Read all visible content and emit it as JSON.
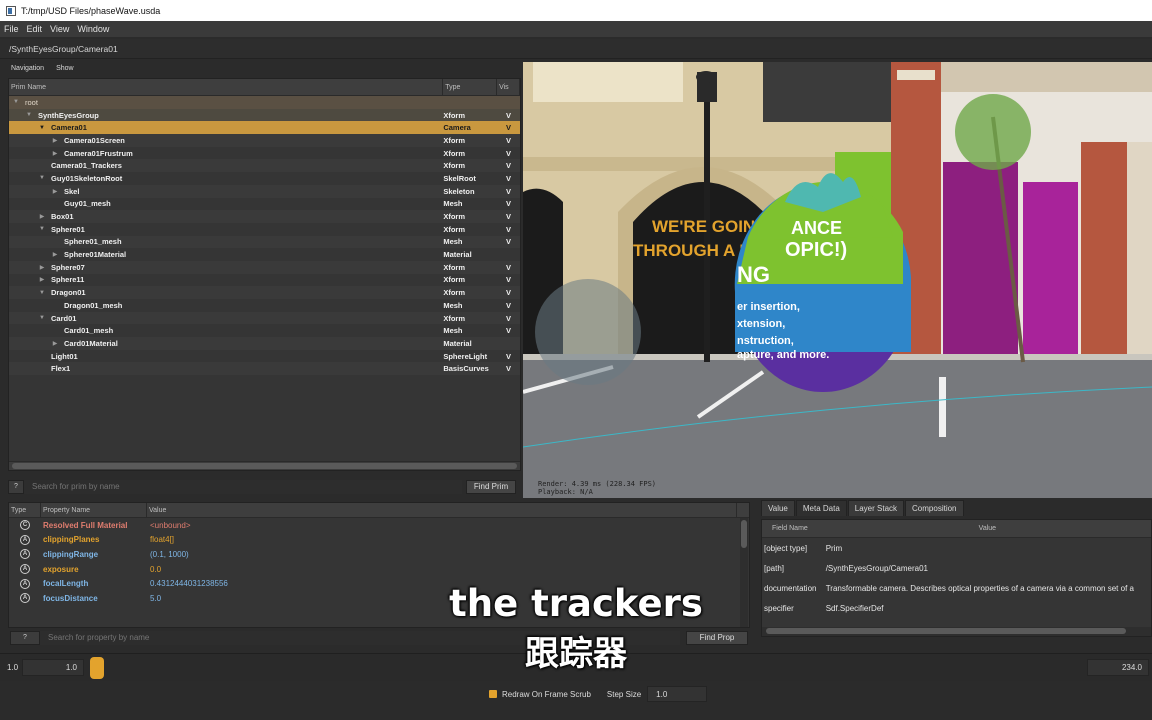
{
  "window": {
    "title": "T:/tmp/USD Files/phaseWave.usda"
  },
  "menu": [
    "File",
    "Edit",
    "View",
    "Window"
  ],
  "path": "/SynthEyesGroup/Camera01",
  "nav": {
    "navigation": "Navigation",
    "show": "Show"
  },
  "tree": {
    "headers": {
      "name": "Prim Name",
      "type": "Type",
      "vis": "Vis"
    },
    "rows": [
      {
        "name": "root",
        "type": "",
        "vis": ""
      },
      {
        "name": "SynthEyesGroup",
        "type": "Xform",
        "vis": "V"
      },
      {
        "name": "Camera01",
        "type": "Camera",
        "vis": "V"
      },
      {
        "name": "Camera01Screen",
        "type": "Xform",
        "vis": "V"
      },
      {
        "name": "Camera01Frustrum",
        "type": "Xform",
        "vis": "V"
      },
      {
        "name": "Camera01_Trackers",
        "type": "Xform",
        "vis": "V"
      },
      {
        "name": "Guy01SkeletonRoot",
        "type": "SkelRoot",
        "vis": "V"
      },
      {
        "name": "Skel",
        "type": "Skeleton",
        "vis": "V"
      },
      {
        "name": "Guy01_mesh",
        "type": "Mesh",
        "vis": "V"
      },
      {
        "name": "Box01",
        "type": "Xform",
        "vis": "V"
      },
      {
        "name": "Sphere01",
        "type": "Xform",
        "vis": "V"
      },
      {
        "name": "Sphere01_mesh",
        "type": "Mesh",
        "vis": "V"
      },
      {
        "name": "Sphere01Material",
        "type": "Material",
        "vis": ""
      },
      {
        "name": "Sphere07",
        "type": "Xform",
        "vis": "V"
      },
      {
        "name": "Sphere11",
        "type": "Xform",
        "vis": "V"
      },
      {
        "name": "Dragon01",
        "type": "Xform",
        "vis": "V"
      },
      {
        "name": "Dragon01_mesh",
        "type": "Mesh",
        "vis": "V"
      },
      {
        "name": "Card01",
        "type": "Xform",
        "vis": "V"
      },
      {
        "name": "Card01_mesh",
        "type": "Mesh",
        "vis": "V"
      },
      {
        "name": "Card01Material",
        "type": "Material",
        "vis": ""
      },
      {
        "name": "Light01",
        "type": "SphereLight",
        "vis": "V"
      },
      {
        "name": "Flex1",
        "type": "BasisCurves",
        "vis": "V"
      }
    ]
  },
  "prim_search": {
    "help": "?",
    "placeholder": "Search for prim by name",
    "button": "Find Prim"
  },
  "viewport": {
    "hud_render": "Render: 4.39 ms (228.34 FPS)",
    "hud_playback": "Playback: N/A",
    "wall_text_1": "WE'RE GOING",
    "wall_text_2": "THROUGH A PHASE",
    "ball_text_1": "ANCE",
    "ball_text_2": "OPIC!)",
    "ball_text_3": "NG",
    "ball_text_4": "er insertion,",
    "ball_text_5": "xtension,",
    "ball_text_6": "nstruction,",
    "ball_text_7": "apture, and more."
  },
  "properties": {
    "headers": {
      "type": "Type",
      "name": "Property Name",
      "value": "Value"
    },
    "rows": [
      {
        "badge": "C",
        "name": "Resolved Full Material",
        "value": "<unbound>",
        "name_color": "#e07d6f",
        "value_color": "#e07d6f"
      },
      {
        "badge": "A",
        "name": "clippingPlanes",
        "value": "float4[]",
        "name_color": "#e3a32d",
        "value_color": "#e3a32d"
      },
      {
        "badge": "A",
        "name": "clippingRange",
        "value": "(0.1, 1000)",
        "name_color": "#7fb6e6",
        "value_color": "#7fb6e6"
      },
      {
        "badge": "A",
        "name": "exposure",
        "value": "0.0",
        "name_color": "#e3a32d",
        "value_color": "#e3a32d"
      },
      {
        "badge": "A",
        "name": "focalLength",
        "value": "0.4312444031238556",
        "name_color": "#7fb6e6",
        "value_color": "#7fb6e6"
      },
      {
        "badge": "A",
        "name": "focusDistance",
        "value": "5.0",
        "name_color": "#7fb6e6",
        "value_color": "#7fb6e6"
      }
    ]
  },
  "prop_search": {
    "help": "?",
    "placeholder": "Search for property by name",
    "button": "Find Prop"
  },
  "meta": {
    "tabs": [
      "Value",
      "Meta Data",
      "Layer Stack",
      "Composition"
    ],
    "headers": {
      "field": "Field Name",
      "value": "Value"
    },
    "rows": [
      {
        "field": "[object type]",
        "value": "Prim"
      },
      {
        "field": "[path]",
        "value": "/SynthEyesGroup/Camera01"
      },
      {
        "field": "documentation",
        "value": "Transformable camera. Describes optical properties of a camera via a common set of a"
      },
      {
        "field": "specifier",
        "value": "Sdf.SpecifierDef"
      }
    ]
  },
  "timeline": {
    "start": "1.0",
    "current": "1.0",
    "end": "234.0"
  },
  "options": {
    "redraw": "Redraw On Frame Scrub",
    "step_label": "Step Size",
    "step_value": "1.0"
  },
  "subtitles": {
    "en": "the trackers",
    "zh": "跟踪器"
  }
}
